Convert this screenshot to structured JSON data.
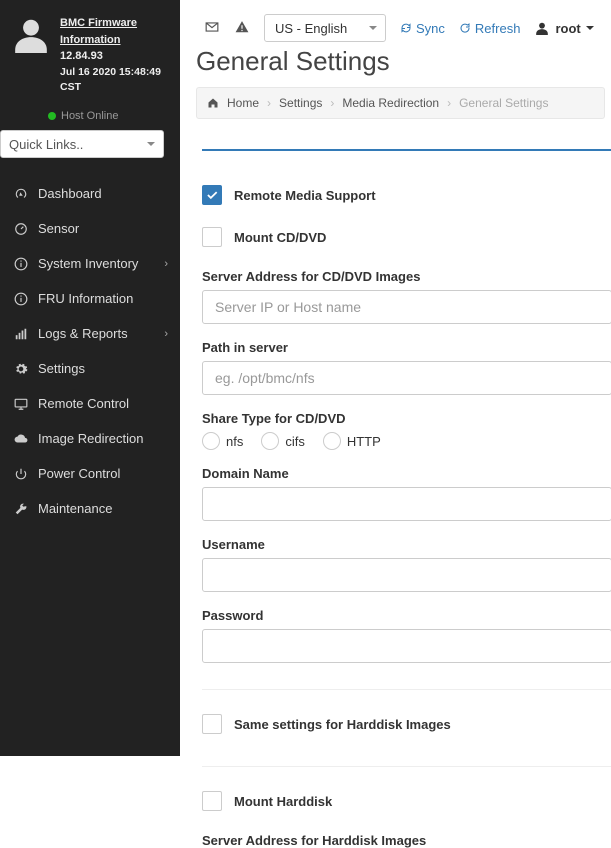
{
  "firmware": {
    "title": "BMC Firmware Information",
    "version": "12.84.93",
    "timestamp": "Jul 16 2020 15:48:49 CST",
    "host_status": "Host Online"
  },
  "quicklinks": {
    "placeholder": "Quick Links.."
  },
  "nav": [
    {
      "key": "dashboard",
      "label": "Dashboard",
      "icon": "tachometer"
    },
    {
      "key": "sensor",
      "label": "Sensor",
      "icon": "dashboard"
    },
    {
      "key": "inventory",
      "label": "System Inventory",
      "icon": "info",
      "chev": true
    },
    {
      "key": "fru",
      "label": "FRU Information",
      "icon": "info"
    },
    {
      "key": "logs",
      "label": "Logs & Reports",
      "icon": "bars",
      "chev": true
    },
    {
      "key": "settings",
      "label": "Settings",
      "icon": "gear"
    },
    {
      "key": "remote",
      "label": "Remote Control",
      "icon": "display"
    },
    {
      "key": "image",
      "label": "Image Redirection",
      "icon": "cloud"
    },
    {
      "key": "power",
      "label": "Power Control",
      "icon": "power"
    },
    {
      "key": "maint",
      "label": "Maintenance",
      "icon": "wrench"
    }
  ],
  "top": {
    "language": "US - English",
    "sync": "Sync",
    "refresh": "Refresh",
    "user": "root"
  },
  "page": {
    "title": "General Settings",
    "breadcrumb": {
      "home": "Home",
      "settings": "Settings",
      "media": "Media Redirection",
      "current": "General Settings"
    }
  },
  "form": {
    "remote_media": {
      "label": "Remote Media Support",
      "checked": true
    },
    "mount_cd": {
      "label": "Mount CD/DVD",
      "checked": false
    },
    "server_address_cd_label": "Server Address for CD/DVD Images",
    "server_address_cd_placeholder": "Server IP or Host name",
    "path_label": "Path in server",
    "path_placeholder": "eg. /opt/bmc/nfs",
    "share_type_label": "Share Type for CD/DVD",
    "share_options": {
      "nfs": "nfs",
      "cifs": "cifs",
      "http": "HTTP"
    },
    "domain_label": "Domain Name",
    "username_label": "Username",
    "password_label": "Password",
    "same_hdd": {
      "label": "Same settings for Harddisk Images",
      "checked": false
    },
    "mount_hdd": {
      "label": "Mount Harddisk",
      "checked": false
    },
    "server_address_hdd_label": "Server Address for Harddisk Images"
  }
}
